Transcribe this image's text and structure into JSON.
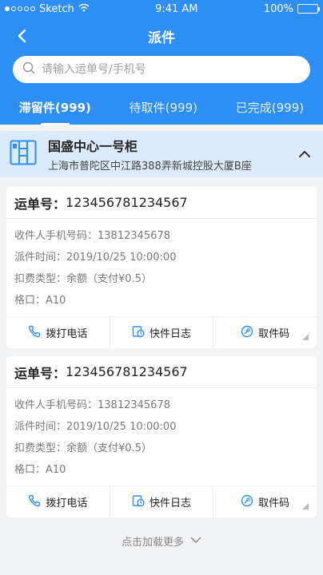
{
  "status": {
    "carrier": "Sketch",
    "time": "9:41 AM",
    "battery": "100%"
  },
  "nav": {
    "title": "派件"
  },
  "search": {
    "placeholder": "请输入运单号/手机号"
  },
  "tabs": [
    {
      "label": "滞留件(999)",
      "active": true
    },
    {
      "label": "待取件(999)",
      "active": false
    },
    {
      "label": "已完成(999)",
      "active": false
    }
  ],
  "cabinet": {
    "name": "国盛中心一号柜",
    "address": "上海市普陀区中江路388弄新城控股大厦B座"
  },
  "cards": [
    {
      "waybill_label": "运单号：",
      "waybill_no": "123456781234567",
      "rows": [
        {
          "label": "收件人手机号码：",
          "value": "13812345678"
        },
        {
          "label": "派件时间：",
          "value": "2019/10/25  10:00:00"
        },
        {
          "label": "扣费类型：",
          "value": "余额（支付¥0.5）"
        },
        {
          "label": "格口：",
          "value": "A10"
        }
      ],
      "actions": {
        "call": "拨打电话",
        "log": "快件日志",
        "code": "取件码"
      }
    },
    {
      "waybill_label": "运单号：",
      "waybill_no": "123456781234567",
      "rows": [
        {
          "label": "收件人手机号码：",
          "value": "13812345678"
        },
        {
          "label": "派件时间：",
          "value": "2019/10/25  10:00:00"
        },
        {
          "label": "扣费类型：",
          "value": "余额（支付¥0.5）"
        },
        {
          "label": "格口：",
          "value": "A10"
        }
      ],
      "actions": {
        "call": "拨打电话",
        "log": "快件日志",
        "code": "取件码"
      }
    }
  ],
  "load_more": "点击加载更多",
  "colors": {
    "primary": "#2d8ef4",
    "cabinet_bg": "#dcebfb",
    "page_bg": "#f3f4f6"
  }
}
